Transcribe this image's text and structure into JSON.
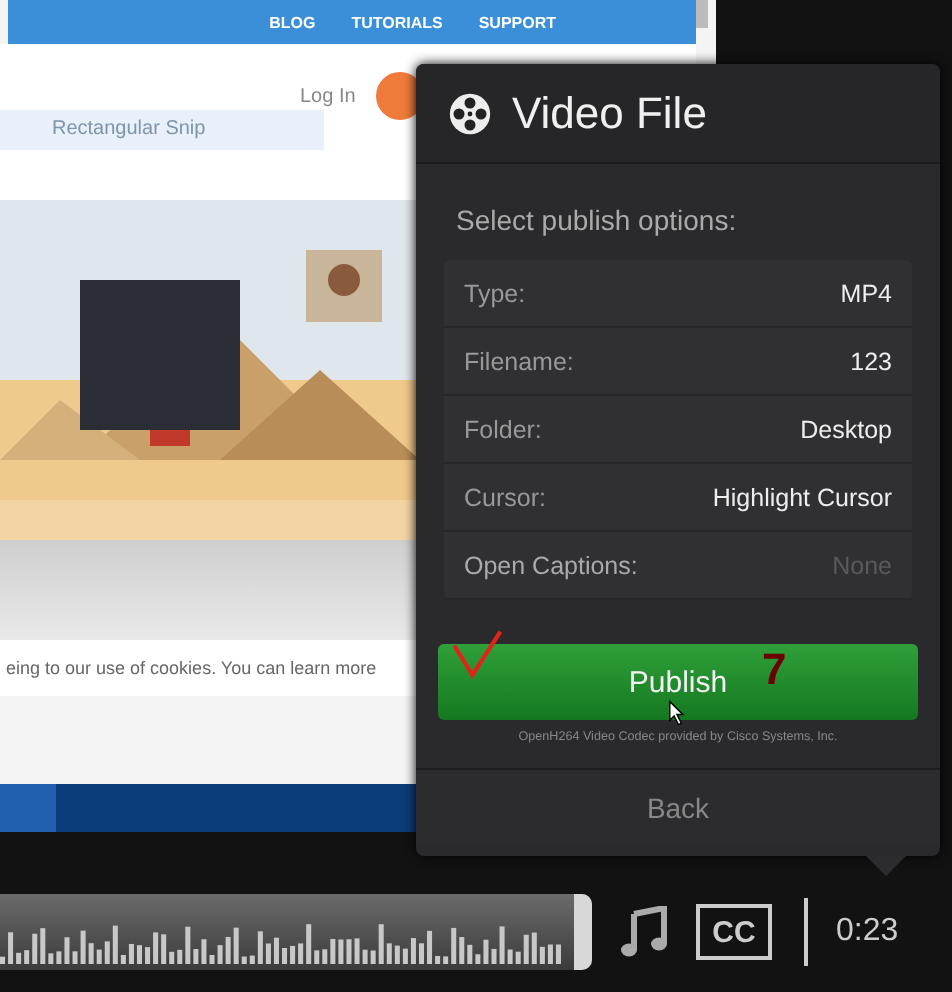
{
  "browser": {
    "nav_links": [
      "BLOG",
      "TUTORIALS",
      "SUPPORT"
    ],
    "login": "Log In",
    "search": {
      "value": "Rectangular Snip"
    },
    "cookie_notice": "eing to our use of cookies. You can learn more"
  },
  "dialog": {
    "title": "Video File",
    "subtitle": "Select publish options:",
    "options": [
      {
        "label": "Type:",
        "value": "MP4",
        "disabled": false
      },
      {
        "label": "Filename:",
        "value": "123",
        "disabled": false
      },
      {
        "label": "Folder:",
        "value": "Desktop",
        "disabled": false
      },
      {
        "label": "Cursor:",
        "value": "Highlight Cursor",
        "disabled": false
      },
      {
        "label": "Open Captions:",
        "value": "None",
        "disabled": true
      }
    ],
    "publish_button": "Publish",
    "annotation": "7",
    "codec_note": "OpenH264 Video Codec provided by Cisco Systems, Inc.",
    "back_button": "Back"
  },
  "player": {
    "captions_button": "CC",
    "time": "0:23"
  }
}
